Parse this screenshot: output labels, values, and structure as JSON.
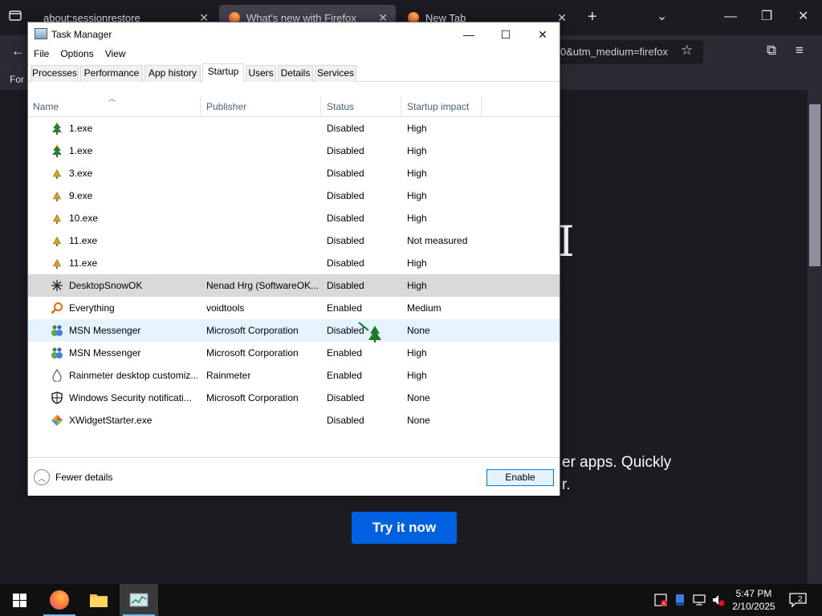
{
  "firefox": {
    "tabs": [
      {
        "title": "about:sessionrestore",
        "active": false
      },
      {
        "title": "What's new with Firefox",
        "active": true
      },
      {
        "title": "New Tab",
        "active": false
      }
    ],
    "url_fragment": "0&utm_medium=firefox",
    "bookmarks_fragment": "For",
    "content_line1": "er apps. Quickly",
    "content_line2": "r.",
    "try_button": "Try it now",
    "colors": {
      "accent": "#0061e0",
      "background": "#1c1b22"
    }
  },
  "task_manager": {
    "title": "Task Manager",
    "menu": [
      "File",
      "Options",
      "View"
    ],
    "tabs": [
      "Processes",
      "Performance",
      "App history",
      "Startup",
      "Users",
      "Details",
      "Services"
    ],
    "active_tab": "Startup",
    "columns": {
      "name": "Name",
      "publisher": "Publisher",
      "status": "Status",
      "impact": "Startup impact"
    },
    "rows": [
      {
        "name": "1.exe",
        "publisher": "",
        "status": "Disabled",
        "impact": "High",
        "icon": "tree-icon"
      },
      {
        "name": "1.exe",
        "publisher": "",
        "status": "Disabled",
        "impact": "High",
        "icon": "tree-icon"
      },
      {
        "name": "3.exe",
        "publisher": "",
        "status": "Disabled",
        "impact": "High",
        "icon": "tree-small-icon"
      },
      {
        "name": "9.exe",
        "publisher": "",
        "status": "Disabled",
        "impact": "High",
        "icon": "tree-small-icon"
      },
      {
        "name": "10.exe",
        "publisher": "",
        "status": "Disabled",
        "impact": "High",
        "icon": "tree-small-icon"
      },
      {
        "name": "11.exe",
        "publisher": "",
        "status": "Disabled",
        "impact": "Not measured",
        "icon": "tree-small-icon"
      },
      {
        "name": "11.exe",
        "publisher": "",
        "status": "Disabled",
        "impact": "High",
        "icon": "tree-small-icon"
      },
      {
        "name": "DesktopSnowOK",
        "publisher": "Nenad Hrg (SoftwareOK...",
        "status": "Disabled",
        "impact": "High",
        "icon": "snowflake-icon"
      },
      {
        "name": "Everything",
        "publisher": "voidtools",
        "status": "Enabled",
        "impact": "Medium",
        "icon": "magnifier-icon"
      },
      {
        "name": "MSN Messenger",
        "publisher": "Microsoft Corporation",
        "status": "Disabled",
        "impact": "None",
        "icon": "msn-icon"
      },
      {
        "name": "MSN Messenger",
        "publisher": "Microsoft Corporation",
        "status": "Enabled",
        "impact": "High",
        "icon": "msn-icon"
      },
      {
        "name": "Rainmeter desktop customiz...",
        "publisher": "Rainmeter",
        "status": "Enabled",
        "impact": "High",
        "icon": "droplet-icon"
      },
      {
        "name": "Windows Security notificati...",
        "publisher": "Microsoft Corporation",
        "status": "Disabled",
        "impact": "None",
        "icon": "shield-icon"
      },
      {
        "name": "XWidgetStarter.exe",
        "publisher": "",
        "status": "Disabled",
        "impact": "None",
        "icon": "xwidget-icon"
      }
    ],
    "fewer_details": "Fewer details",
    "enable_button": "Enable"
  },
  "taskbar": {
    "clock_time": "5:47 PM",
    "clock_date": "2/10/2025",
    "notification_count": "2"
  }
}
